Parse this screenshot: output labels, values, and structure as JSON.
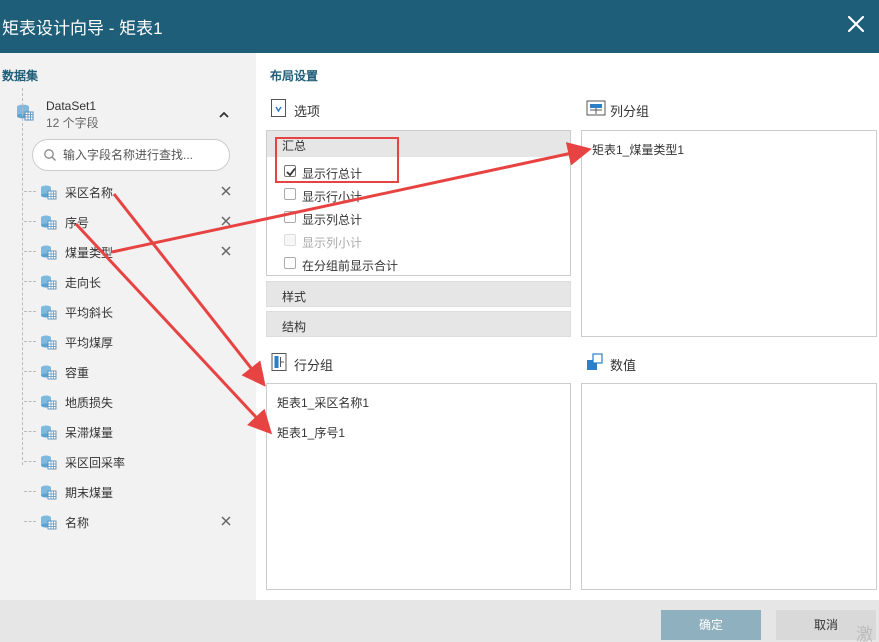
{
  "window": {
    "title": "矩表设计向导 - 矩表1"
  },
  "left_panel": {
    "title": "数据集",
    "dataset": {
      "name": "DataSet1",
      "field_count": "12 个字段"
    },
    "search": {
      "placeholder": "输入字段名称进行查找..."
    },
    "fields": [
      {
        "name": "采区名称",
        "removable": true
      },
      {
        "name": "序号",
        "removable": true
      },
      {
        "name": "煤量类型",
        "removable": true
      },
      {
        "name": "走向长",
        "removable": false
      },
      {
        "name": "平均斜长",
        "removable": false
      },
      {
        "name": "平均煤厚",
        "removable": false
      },
      {
        "name": "容重",
        "removable": false
      },
      {
        "name": "地质损失",
        "removable": false
      },
      {
        "name": "呆滞煤量",
        "removable": false
      },
      {
        "name": "采区回采率",
        "removable": false
      },
      {
        "name": "期末煤量",
        "removable": false
      },
      {
        "name": "名称",
        "removable": true
      }
    ]
  },
  "layout": {
    "title": "布局设置",
    "options": {
      "label": "选项",
      "summary_section": "汇总",
      "checkboxes": [
        {
          "label": "显示行总计",
          "checked": true,
          "disabled": false
        },
        {
          "label": "显示行小计",
          "checked": false,
          "disabled": false
        },
        {
          "label": "显示列总计",
          "checked": false,
          "disabled": false
        },
        {
          "label": "显示列小计",
          "checked": false,
          "disabled": true
        },
        {
          "label": "在分组前显示合计",
          "checked": false,
          "disabled": false
        }
      ],
      "style_section": "样式",
      "structure_section": "结构"
    },
    "column_groups": {
      "label": "列分组",
      "items": [
        "矩表1_煤量类型1"
      ]
    },
    "row_groups": {
      "label": "行分组",
      "items": [
        "矩表1_采区名称1",
        "矩表1_序号1"
      ]
    },
    "values": {
      "label": "数值",
      "items": []
    }
  },
  "footer": {
    "ok_label": "确定",
    "cancel_label": "取消"
  },
  "watermark": "激",
  "colors": {
    "title_bar": "#1f5e78",
    "accent": "#1f5e78",
    "annotation": "#e84343",
    "ok_button": "#8fb0bf"
  }
}
